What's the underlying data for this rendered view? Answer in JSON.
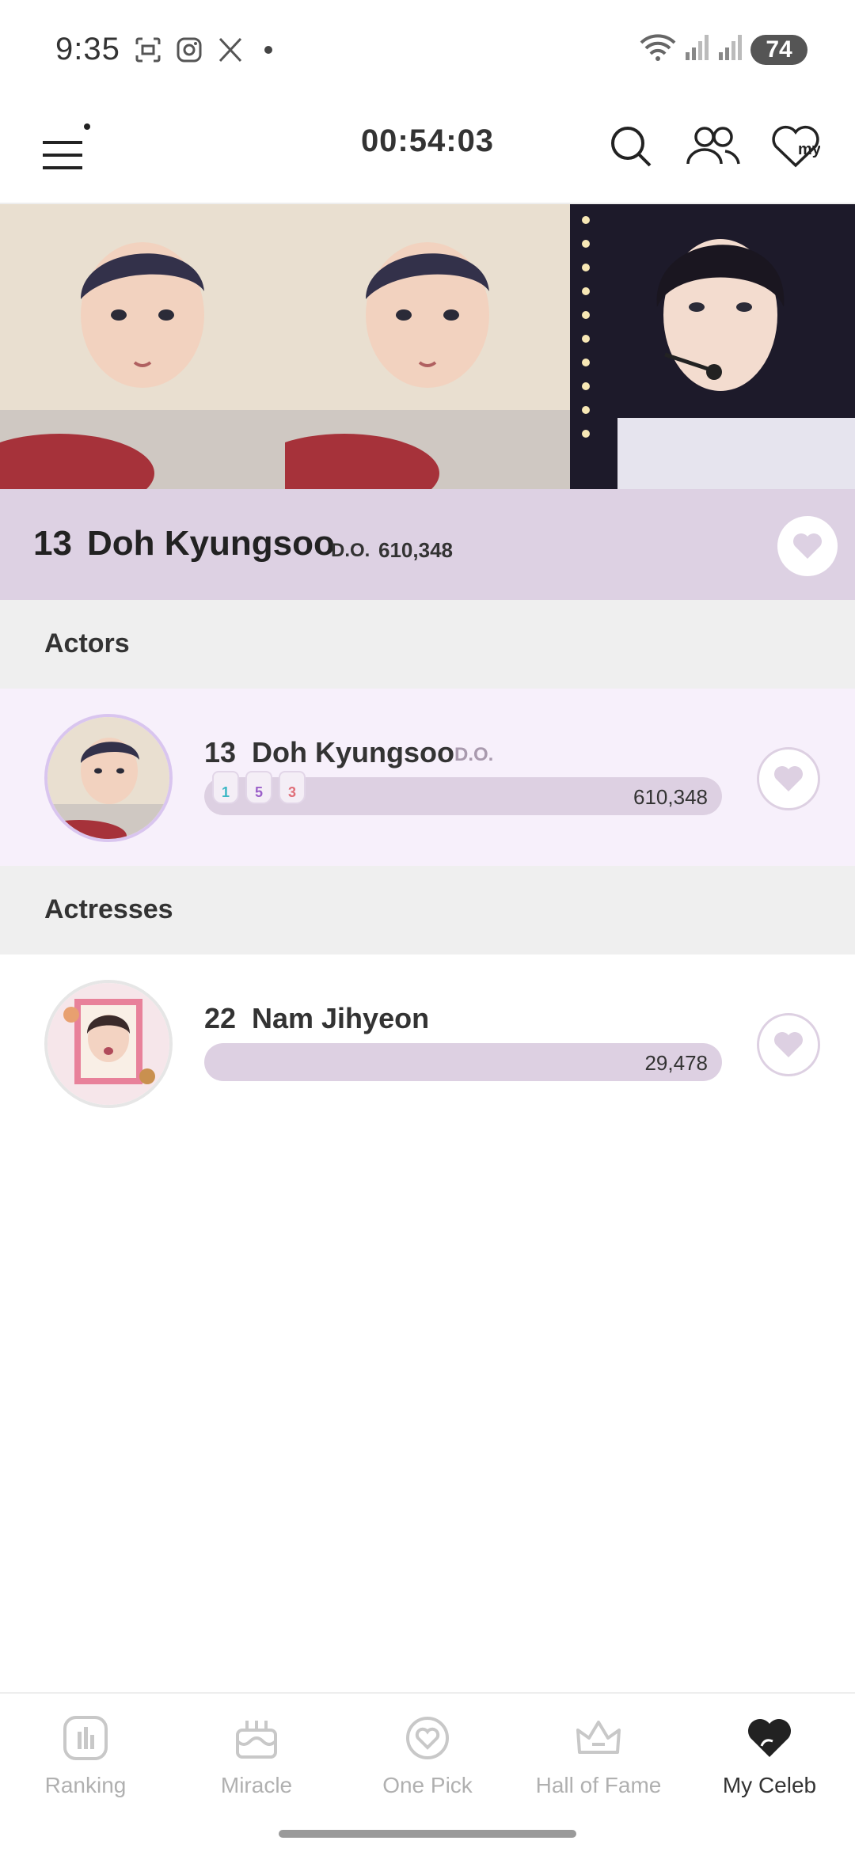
{
  "status": {
    "time": "9:35",
    "battery": "74",
    "left_icons": [
      "screenshot-icon",
      "instagram-icon",
      "x-icon"
    ],
    "right_icons": [
      "wifi-icon",
      "signal-icon",
      "signal-icon"
    ]
  },
  "app_bar": {
    "timer": "00:54:03",
    "actions": [
      "search-icon",
      "people-icon",
      "my-heart-icon"
    ]
  },
  "feature": {
    "rank": "13",
    "name": "Doh Kyungsoo",
    "group": "D.O.",
    "votes": "610,348"
  },
  "sections": [
    {
      "title": "Actors",
      "items": [
        {
          "rank": "13",
          "name": "Doh Kyungsoo",
          "group": "D.O.",
          "votes": "610,348",
          "progress": 1.0,
          "highlighted": true,
          "badges": [
            "1",
            "5",
            "3"
          ]
        }
      ]
    },
    {
      "title": "Actresses",
      "items": [
        {
          "rank": "22",
          "name": "Nam Jihyeon",
          "group": "",
          "votes": "29,478",
          "progress": 1.0,
          "highlighted": false,
          "badges": []
        }
      ]
    }
  ],
  "nav": {
    "items": [
      {
        "label": "Ranking",
        "icon": "ranking-icon"
      },
      {
        "label": "Miracle",
        "icon": "cake-icon"
      },
      {
        "label": "One Pick",
        "icon": "heart-circle-icon"
      },
      {
        "label": "Hall of Fame",
        "icon": "crown-icon"
      },
      {
        "label": "My Celeb",
        "icon": "my-heart-icon"
      }
    ],
    "active_index": 4
  },
  "colors": {
    "accent": "#ddd1e3",
    "highlight_row": "#f7f0fb",
    "section_bg": "#efefef"
  }
}
